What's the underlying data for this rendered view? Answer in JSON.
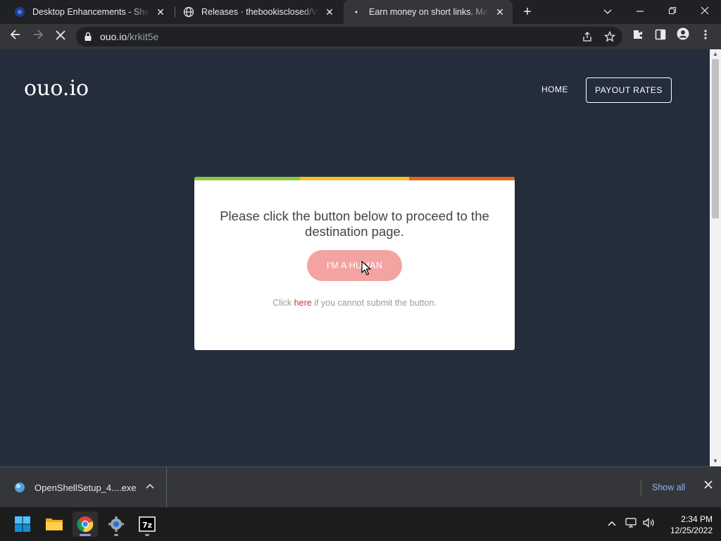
{
  "browser": {
    "tabs": [
      {
        "title": "Desktop Enhancements - Shell Re",
        "icon": "shell-favicon-icon",
        "active": false
      },
      {
        "title": "Releases · thebookisclosed/ViVe",
        "icon": "globe-icon",
        "active": false
      },
      {
        "title": "Earn money on short links. Make",
        "icon": "loading-icon",
        "active": true
      }
    ],
    "url_host": "ouo.io",
    "url_path": "/krkit5e"
  },
  "page": {
    "brand": "ouo.io",
    "nav": {
      "home": "HOME",
      "payout": "PAYOUT RATES"
    },
    "card": {
      "message": "Please click the button below to proceed to the destination page.",
      "button": "I'M A HUMAN",
      "note_prefix": "Click",
      "note_link": "here",
      "note_suffix": "if you cannot submit the button.",
      "bar_colors": [
        "#8dc63f",
        "#f6bf26",
        "#e8641e"
      ]
    }
  },
  "download_bar": {
    "file": "OpenShellSetup_4....exe",
    "show_all": "Show all"
  },
  "taskbar": {
    "time": "2:34 PM",
    "date": "12/25/2022"
  }
}
